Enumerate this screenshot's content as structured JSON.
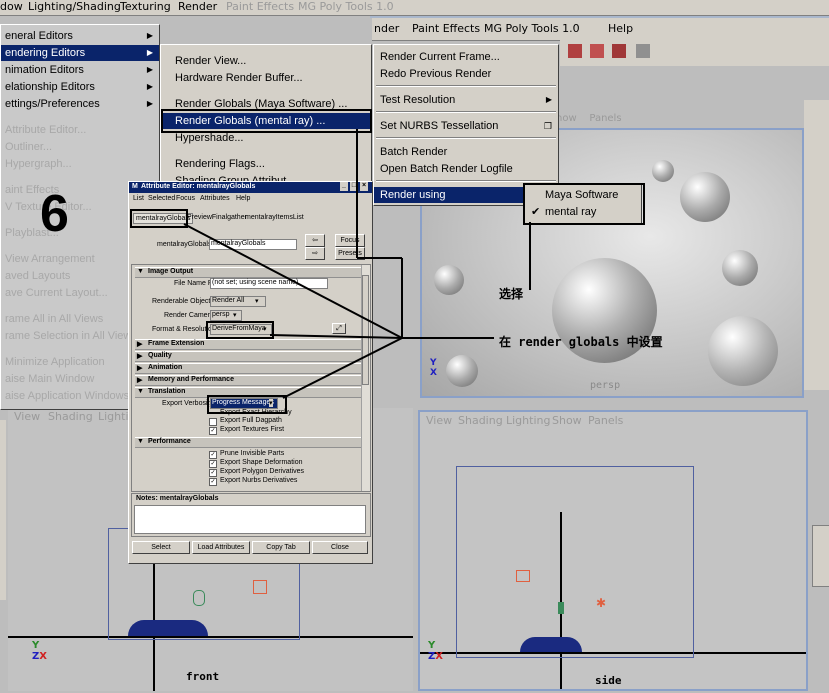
{
  "menubar": {
    "items": [
      "dow",
      "Lighting/Shading",
      "Texturing",
      "Render",
      "Paint Effects",
      "MG Poly Tools 1.0",
      "Help"
    ]
  },
  "window_menu": {
    "items": [
      {
        "label": "eneral Editors"
      },
      {
        "label": "endering Editors"
      },
      {
        "label": "nimation Editors"
      },
      {
        "label": "elationship Editors"
      },
      {
        "label": "ettings/Preferences"
      }
    ],
    "faded_items": [
      "Attribute Editor...",
      "Outliner...",
      "Hypergraph...",
      "aint Effects",
      "V Texture Editor...",
      "Playblast...",
      "View Arrangement",
      "aved Layouts",
      "ave Current Layout...",
      "rame All in All Views",
      "rame Selection in All Views",
      "Minimize Application",
      "aise Main Window",
      "aise Application Windows"
    ]
  },
  "rendering_submenu": {
    "items": [
      "Render View...",
      "Hardware Render Buffer...",
      "Render Globals (Maya Software) ...",
      "Render Globals (mental ray) ...",
      "Hypershade...",
      "Rendering Flags...",
      "Shading Group Attribut..."
    ]
  },
  "render_menu": {
    "items": [
      "Render Current Frame...",
      "Redo Previous Render",
      "Test Resolution",
      "Set NURBS Tessellation",
      "Batch Render",
      "Open Batch Render Logfile",
      "Render using"
    ]
  },
  "render_using_submenu": {
    "items": [
      {
        "label": "Maya Software",
        "checked": false
      },
      {
        "label": "mental ray",
        "checked": true
      }
    ]
  },
  "step_number": "6",
  "annotations": {
    "select_label": "选择",
    "set_in_label": "在 render globals 中设置"
  },
  "attribute_editor": {
    "title": "Attribute Editor: mentalrayGlobals",
    "menu": [
      "List",
      "Selected",
      "Focus",
      "Attributes",
      "Help"
    ],
    "tabs": [
      "mentalrayGlobals",
      "PreviewFinalgather",
      "mentalrayItemsList"
    ],
    "node_label": "mentalrayGlobals:",
    "node_value": "mentalrayGlobals",
    "focus_button": "Focus",
    "presets_button": "Presets",
    "sections": {
      "image_output": "Image Output",
      "frame_extension": "Frame Extension",
      "quality": "Quality",
      "animation": "Animation",
      "memory": "Memory and Performance",
      "translation": "Translation",
      "performance": "Performance"
    },
    "file_name_prefix_label": "File Name Prefix",
    "file_name_prefix_value": "(not set; using scene name)",
    "renderable_objects_label": "Renderable Objects",
    "renderable_objects_value": "Render All",
    "render_camera_label": "Render Camera",
    "render_camera_value": "persp",
    "format_label": "Format & Resolution",
    "format_value": "DeriveFromMaya",
    "export_verbosity_label": "Export Verbosity",
    "export_verbosity_value": "Progress Messages",
    "translation_checks": [
      {
        "label": "Export Exact Hierarchy",
        "checked": false
      },
      {
        "label": "Export Full Dagpath",
        "checked": false
      },
      {
        "label": "Export Textures First",
        "checked": true
      }
    ],
    "performance_checks": [
      {
        "label": "Prune Invisible Parts",
        "checked": true
      },
      {
        "label": "Export Shape Deformation",
        "checked": true
      },
      {
        "label": "Export Polygon Derivatives",
        "checked": true
      },
      {
        "label": "Export Nurbs Derivatives",
        "checked": true
      }
    ],
    "notes_label": "Notes: mentalrayGlobals",
    "buttons": [
      "Select",
      "Load Attributes",
      "Copy Tab",
      "Close"
    ]
  },
  "viewports": {
    "persp_label": "persp",
    "front_label": "front",
    "side_label": "side",
    "panel_menu": [
      "View",
      "Shading",
      "Lighting",
      "Show",
      "Panels"
    ],
    "front_panel_menu": [
      "View",
      "Shading",
      "Lighting"
    ],
    "top_panel_fragment": [
      "now",
      "Panels"
    ]
  }
}
